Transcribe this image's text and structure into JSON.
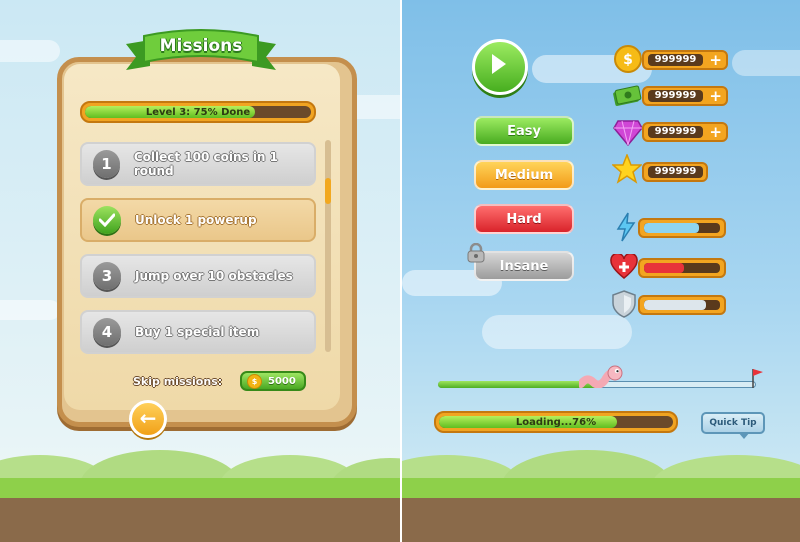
{
  "missions_panel": {
    "title": "Missions",
    "level_progress": {
      "label": "Level 3: 75% Done",
      "percent": 75
    },
    "missions": [
      {
        "number": "1",
        "text": "Collect 100 coins in 1 round",
        "completed": false
      },
      {
        "number": "",
        "text": "Unlock 1 powerup",
        "completed": true
      },
      {
        "number": "3",
        "text": "Jump over 10 obstacles",
        "completed": false
      },
      {
        "number": "4",
        "text": "Buy 1 special item",
        "completed": false
      }
    ],
    "skip_label": "Skip missions:",
    "skip_cost": "5000",
    "skip_coin_symbol": "$",
    "back_icon": "arrow-left-icon"
  },
  "menu": {
    "play_icon": "play-icon",
    "difficulties": [
      {
        "label": "Easy",
        "color": "#5fbe21"
      },
      {
        "label": "Medium",
        "color": "#f29b18"
      },
      {
        "label": "Hard",
        "color": "#d9232a"
      },
      {
        "label": "Insane",
        "color": "#9c9c9c",
        "locked": true
      }
    ]
  },
  "currencies": [
    {
      "icon": "coin-icon",
      "value": "999999",
      "has_plus": true
    },
    {
      "icon": "cash-icon",
      "value": "999999",
      "has_plus": true
    },
    {
      "icon": "gem-icon",
      "value": "999999",
      "has_plus": true
    },
    {
      "icon": "star-icon",
      "value": "999999",
      "has_plus": false
    }
  ],
  "plus_symbol": "+",
  "stat_bars": [
    {
      "icon": "lightning-icon",
      "fill_fraction": 0.72,
      "color": "#8fd4ef"
    },
    {
      "icon": "heart-plus-icon",
      "fill_fraction": 0.52,
      "color": "#e8333a"
    },
    {
      "icon": "shield-icon",
      "fill_fraction": 0.82,
      "color": "#dde6ec"
    }
  ],
  "level_slider": {
    "progress_fraction": 0.52,
    "player_icon": "worm-icon",
    "goal_icon": "flag-icon"
  },
  "loading": {
    "label": "Loading...76%",
    "percent": 76
  },
  "quick_tip": {
    "label": "Quick Tip"
  }
}
